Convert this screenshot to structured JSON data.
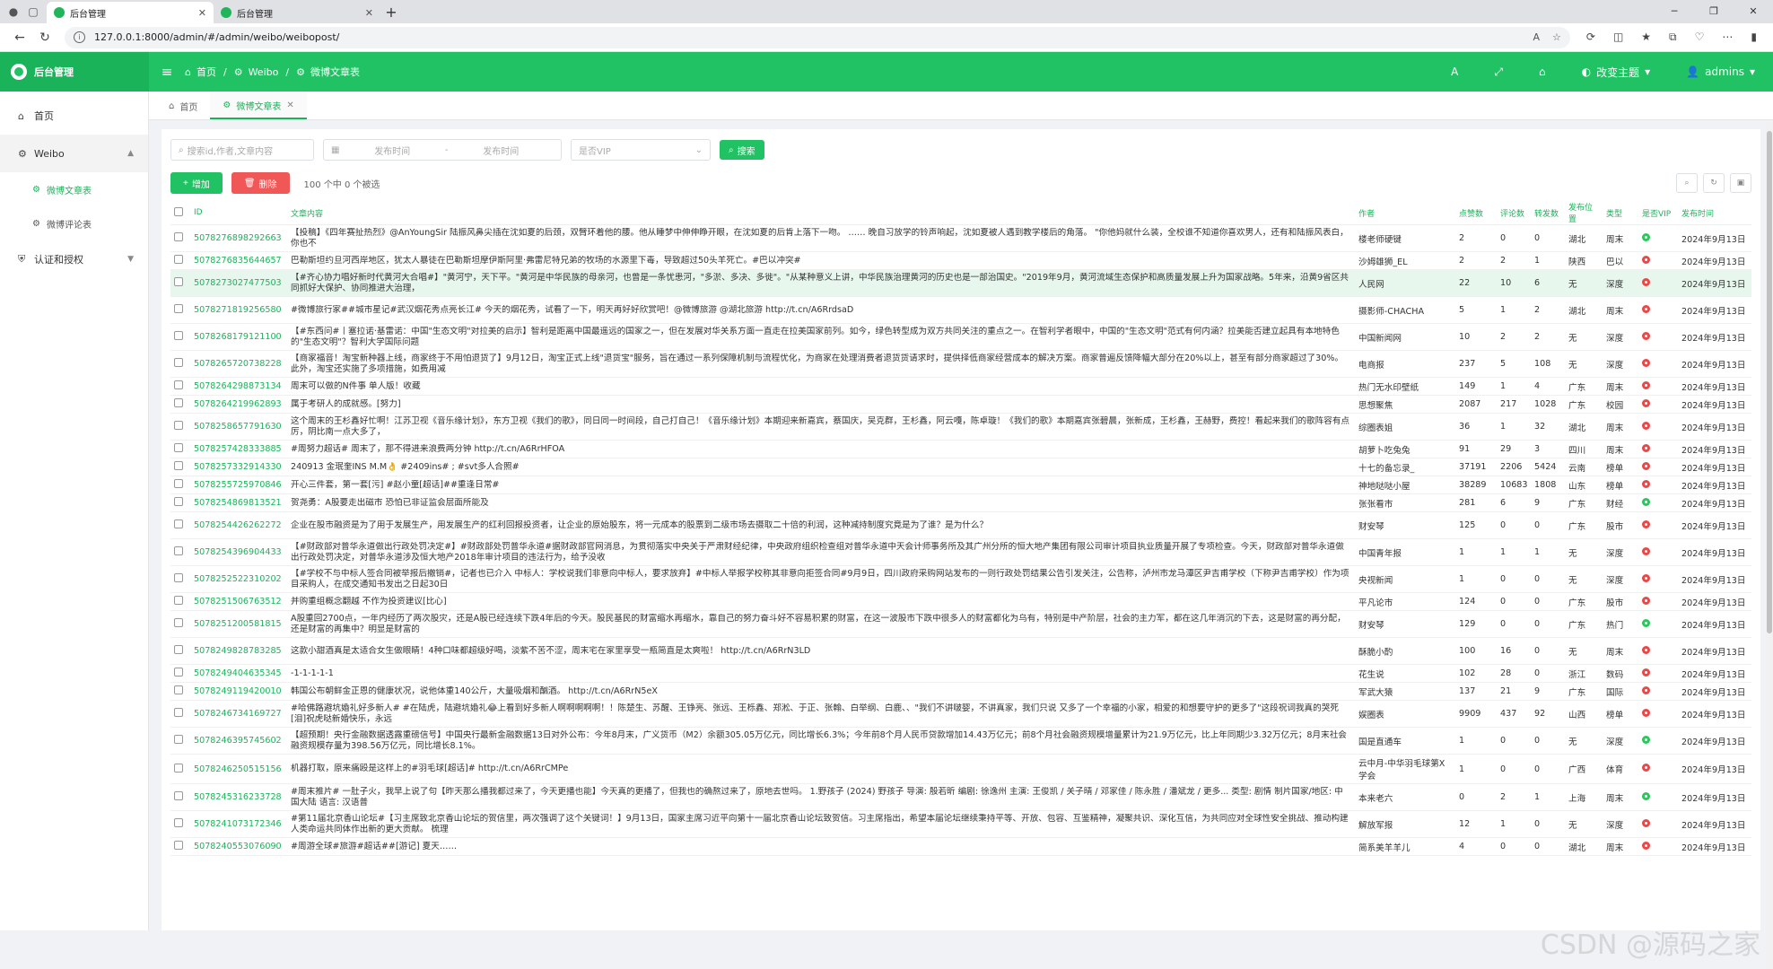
{
  "browser": {
    "tabs": [
      {
        "title": "后台管理",
        "active": true
      },
      {
        "title": "后台管理",
        "active": false
      }
    ],
    "url": "127.0.0.1:8000/admin/#/admin/weibo/weibopost/"
  },
  "header": {
    "brand": "后台管理",
    "breadcrumb": [
      "首页",
      "Weibo",
      "微博文章表"
    ],
    "theme_label": "改变主题",
    "user": "admins"
  },
  "sidebar": {
    "home": "首页",
    "weibo": "Weibo",
    "sub": [
      "微博文章表",
      "微博评论表"
    ],
    "auth": "认证和授权"
  },
  "pagetabs": [
    "首页",
    "微博文章表"
  ],
  "search": {
    "keyword_placeholder": "搜索id,作者,文章内容",
    "start_placeholder": "发布时间",
    "range_sep": "-",
    "end_placeholder": "发布时间",
    "vip_placeholder": "是否VIP",
    "search_btn": "搜索"
  },
  "actions": {
    "add": "增加",
    "delete": "删除",
    "selection": "100 个中 0 个被选"
  },
  "table": {
    "headers": [
      "ID",
      "文章内容",
      "作者",
      "点赞数",
      "评论数",
      "转发数",
      "发布位置",
      "类型",
      "是否VIP",
      "发布时间"
    ],
    "rows": [
      [
        "5078276898292663",
        "【投稿】《四年赛扯热烈》@AnYoungSir 陆振风鼻尖插在沈如夏的后颈，双臂环着他的腰。他从睡梦中伸伸睁开眼，在沈如夏的后肯上落下一吻。 …… 晚自习放学的铃声响起，沈如夏被人遇到教学楼后的角落。 \"你他妈就什么装，全校谁不知道你喜欢男人，还有和陆振风表白，你也不",
        "楼老师硬键",
        "2",
        "0",
        "0",
        "湖北",
        "周末",
        "yes",
        "2024年9月13日"
      ],
      [
        "5078276835644657",
        "巴勒斯坦约旦河西岸地区，犹太人暴徒在巴勒斯坦摩伊斯阿里·弗雷尼特兄弟的牧场的水源里下毒，导致超过50头羊死亡。#巴以冲突#",
        "沙姆雄狮_EL",
        "2",
        "2",
        "1",
        "陕西",
        "巴以",
        "no",
        "2024年9月13日"
      ],
      [
        "5078273027477503",
        "【#齐心协力唱好新时代黄河大合唱#】\"黄河宁，天下平。\"黄河是中华民族的母亲河，也曾是一条忧患河，\"多淤、多决、多徙\"。\"从某种意义上讲，中华民族治理黄河的历史也是一部治国史。\"2019年9月，黄河流域生态保护和高质量发展上升为国家战略。5年来，沿黄9省区共同抓好大保护、协同推进大治理，",
        "人民网",
        "22",
        "10",
        "6",
        "无",
        "深度",
        "no",
        "2024年9月13日"
      ],
      [
        "5078271819256580",
        "#微博旅行家##城市星记#武汉烟花秀点亮长江# 今天的烟花秀，试看了一下，明天再好好欣赏吧！@微博旅游 @湖北旅游 http://t.cn/A6RrdsaD",
        "摄影师-CHACHA",
        "5",
        "1",
        "2",
        "湖北",
        "周末",
        "no",
        "2024年9月13日"
      ],
      [
        "5078268179121100",
        "【#东西问#丨塞拉诺·基雷诺：中国\"生态文明\"对拉美的启示】智利是距离中国最遥远的国家之一，但在发展对华关系方面一直走在拉美国家前列。如今，绿色转型成为双方共同关注的重点之一。在智利学者眼中，中国的\"生态文明\"范式有何内涵？拉美能否建立起具有本地特色的\"生态文明\"？智利大学国际问题",
        "中国新闻网",
        "10",
        "2",
        "2",
        "无",
        "深度",
        "no",
        "2024年9月13日"
      ],
      [
        "5078265720738228",
        "【商家福音！淘宝新种器上线，商家终于不用怕退货了】9月12日，淘宝正式上线\"退货宝\"服务，旨在通过一系列保障机制与流程优化，为商家在处理消费者退货货请求时，提供择低商家经营成本的解决方案。商家普遍反馈降幅大部分在20%以上，甚至有部分商家超过了30%。此外，淘宝还实施了多项措施，如费用减",
        "电商报",
        "237",
        "5",
        "108",
        "无",
        "深度",
        "no",
        "2024年9月13日"
      ],
      [
        "5078264298873134",
        "周末可以做的N件事 单人版！收藏",
        "热门无水印壁纸",
        "149",
        "1",
        "4",
        "广东",
        "周末",
        "no",
        "2024年9月13日"
      ],
      [
        "5078264219962893",
        "属于考研人的成就感。[努力]",
        "思想聚焦",
        "2087",
        "217",
        "1028",
        "广东",
        "校园",
        "no",
        "2024年9月13日"
      ],
      [
        "5078258657791630",
        "这个周末的王杉鑫好忙啊！江苏卫视《音乐缘计划》，东方卫视《我们的歌》，同日同一时间段，自己打自己！《音乐缘计划》本期迎来新嘉宾，蔡国庆，吴克群，王杉鑫，阿云嘎，陈卓璇！《我们的歌》本期嘉宾张碧晨，张新成，王杉鑫，王赫野，费控！看起来我们的歌阵容有点厉，阴比南一点大多了，",
        "综圈表姐",
        "36",
        "1",
        "32",
        "湖北",
        "周末",
        "no",
        "2024年9月13日"
      ],
      [
        "5078257428333885",
        "#周努力超话# 周末了，那不得进来浪费两分钟 http://t.cn/A6RrHFOA",
        "胡萝卜吃兔兔",
        "91",
        "29",
        "3",
        "四川",
        "周末",
        "no",
        "2024年9月13日"
      ],
      [
        "5078257332914330",
        "240913 金珉奎INS M.M👌 #2409ins# ; #svt多人合照#",
        "十七的备忘录_",
        "37191",
        "2206",
        "5424",
        "云南",
        "榜单",
        "no",
        "2024年9月13日"
      ],
      [
        "5078255725970846",
        "开心三件套，第一套[污] #赵小童[超话]##重逢日常#",
        "神地哒哒小屋",
        "38289",
        "10683",
        "1808",
        "山东",
        "榜单",
        "no",
        "2024年9月13日"
      ],
      [
        "5078254869813521",
        "贺尧勇：A股要走出磁市 恐怕已非证监会层面所能及",
        "张张看市",
        "281",
        "6",
        "9",
        "广东",
        "财经",
        "yes",
        "2024年9月13日"
      ],
      [
        "5078254426262272",
        "企业在股市融资是为了用于发展生产，用发展生产的红利回报投资者，让企业的原始股东，将一元成本的股票到二级市场去摄取二十倍的利润，这种减持制度究竟是为了谁？是为什么？",
        "财安琴",
        "125",
        "0",
        "0",
        "广东",
        "股市",
        "no",
        "2024年9月13日"
      ],
      [
        "5078254396904433",
        "【#财政部对普华永道做出行政处罚决定#】#财政部处罚普华永道#据财政部官网消息，为贯彻落实中央关于严肃财经纪律，中央政府组织检查组对普华永道中天会计师事务所及其广州分所的恒大地产集团有限公司审计项目执业质量开展了专项检查。今天，财政部对普华永道做出行政处罚决定，对普华永道涉及恒大地产2018年审计项目的违法行为，给予没收",
        "中国青年报",
        "1",
        "1",
        "1",
        "无",
        "深度",
        "no",
        "2024年9月13日"
      ],
      [
        "5078252522310202",
        "【#学校不与中标人签合同被举报后撤销#，记者也已介入 中标人：学校说我们非意向中标人，要求放弃】#中标人举报学校称其非意向拒签合同#9月9日，四川政府采购网站发布的一则行政处罚结果公告引发关注，公告称，泸州市龙马潭区尹吉甫学校（下称尹吉甫学校）作为项目采购人，在成交通知书发出之日起30日",
        "央视新闻",
        "1",
        "0",
        "0",
        "无",
        "深度",
        "no",
        "2024年9月13日"
      ],
      [
        "5078251506763512",
        "并购重组概念翻越 不作为投资建议[比心]",
        "平凡论市",
        "124",
        "0",
        "0",
        "广东",
        "股市",
        "no",
        "2024年9月13日"
      ],
      [
        "5078251200581815",
        "A股重回2700点，一年内经历了两次股灾，还是A股已经连续下跌4年后的今天。股民基民的财富缩水再缩水，靠自己的努力奋斗好不容易积累的财富，在这一波股市下跌中很多人的财富都化为乌有，特别是中产阶层，社会的主力军，都在这几年消沉的下去，这是财富的再分配，还是财富的再集中？明显是财富的",
        "财安琴",
        "129",
        "0",
        "0",
        "广东",
        "热门",
        "yes",
        "2024年9月13日"
      ],
      [
        "5078249828783285",
        "这款小甜酒真是太适合女生做眼睛！4种口味都超级好喝，淡紫不苦不涩，周末宅在家里享受一瓶简直是太爽啦！ http://t.cn/A6RrN3LD",
        "酥脆小酌",
        "100",
        "16",
        "0",
        "无",
        "周末",
        "no",
        "2024年9月13日"
      ],
      [
        "5078249404635345",
        "-1-1-1-1-1",
        "花生说",
        "102",
        "28",
        "0",
        "浙江",
        "数码",
        "no",
        "2024年9月13日"
      ],
      [
        "5078249119420010",
        "韩国公布朝鲜金正恩的健康状况，说他体重140公斤，大量吸烟和酗酒。 http://t.cn/A6RrN5eX",
        "军武大猿",
        "137",
        "21",
        "9",
        "广东",
        "国际",
        "no",
        "2024年9月13日"
      ],
      [
        "5078246734169727",
        "#哈佛路避坑婚礼好多新人# #在陆虎，陆避坑婚礼😂上看到好多新人啊啊啊啊啊！！陈楚生、苏醒、王铮亮、张远、王栎鑫、郑淞、于正、张翰、白举纲、白鹿、、\"我们不讲啵婴，不讲真家，我们只说 又多了一个幸福的小家，相爱的和想要守护的更多了\"这段祝词我真的哭死[泪]祝虎哒新婚快乐，永远",
        "娱圈表",
        "9909",
        "437",
        "92",
        "山西",
        "榜单",
        "no",
        "2024年9月13日"
      ],
      [
        "5078246395745602",
        "【超预期！央行金融数据透露重磅信号】中国央行最新金融数据13日对外公布：今年8月末，广义货币（M2）余额305.05万亿元，同比增长6.3%；今年前8个月人民币贷款增加14.43万亿元；前8个月社会融资规模增量累计为21.9万亿元，比上年同期少3.32万亿元；8月末社会融资规模存量为398.56万亿元，同比增长8.1%。",
        "国是直通车",
        "1",
        "0",
        "0",
        "无",
        "深度",
        "yes",
        "2024年9月13日"
      ],
      [
        "5078246250515156",
        "机器打取，原来痛殴是这样上的#羽毛球[超话]# http://t.cn/A6RrCMPe",
        "云中月-中华羽毛球第X 学会",
        "1",
        "0",
        "0",
        "广西",
        "体育",
        "no",
        "2024年9月13日"
      ],
      [
        "5078245316233728",
        "#周末推片# 一肚子火，我早上说了句【昨天那么播我都过来了，今天更播也能】今天真的更播了，但我也的确熬过来了，原地去世吗。 1.野孩子 (2024) 野孩子 导演: 殷若昕 编剧: 徐逸州 主演: 王俊凯 / 关子晴 / 邓家佳 / 陈永胜 / 潘斌龙 / 更多... 类型: 剧情 制片国家/地区: 中国大陆 语言: 汉语普",
        "本来老六",
        "0",
        "2",
        "1",
        "上海",
        "周末",
        "yes",
        "2024年9月13日"
      ],
      [
        "5078241073172346",
        "#第11届北京香山论坛#【习主席致北京香山论坛的贺信里，两次强调了这个关键词！】9月13日，国家主席习近平向第十一届北京香山论坛致贺信。习主席指出，希望本届论坛继续秉持平等、开放、包容、互鉴精神，凝聚共识、深化互信，为共同应对全球性安全挑战、推动构建人类命运共同体作出新的更大贡献。 梳理",
        "解放军报",
        "12",
        "1",
        "0",
        "无",
        "深度",
        "no",
        "2024年9月13日"
      ],
      [
        "5078240553076090",
        "#周游全球#旅游#超话##[游记] 夏天……",
        "简系美羊羊儿",
        "4",
        "0",
        "0",
        "湖北",
        "周末",
        "no",
        "2024年9月13日"
      ]
    ]
  },
  "watermark": "CSDN @源码之家"
}
